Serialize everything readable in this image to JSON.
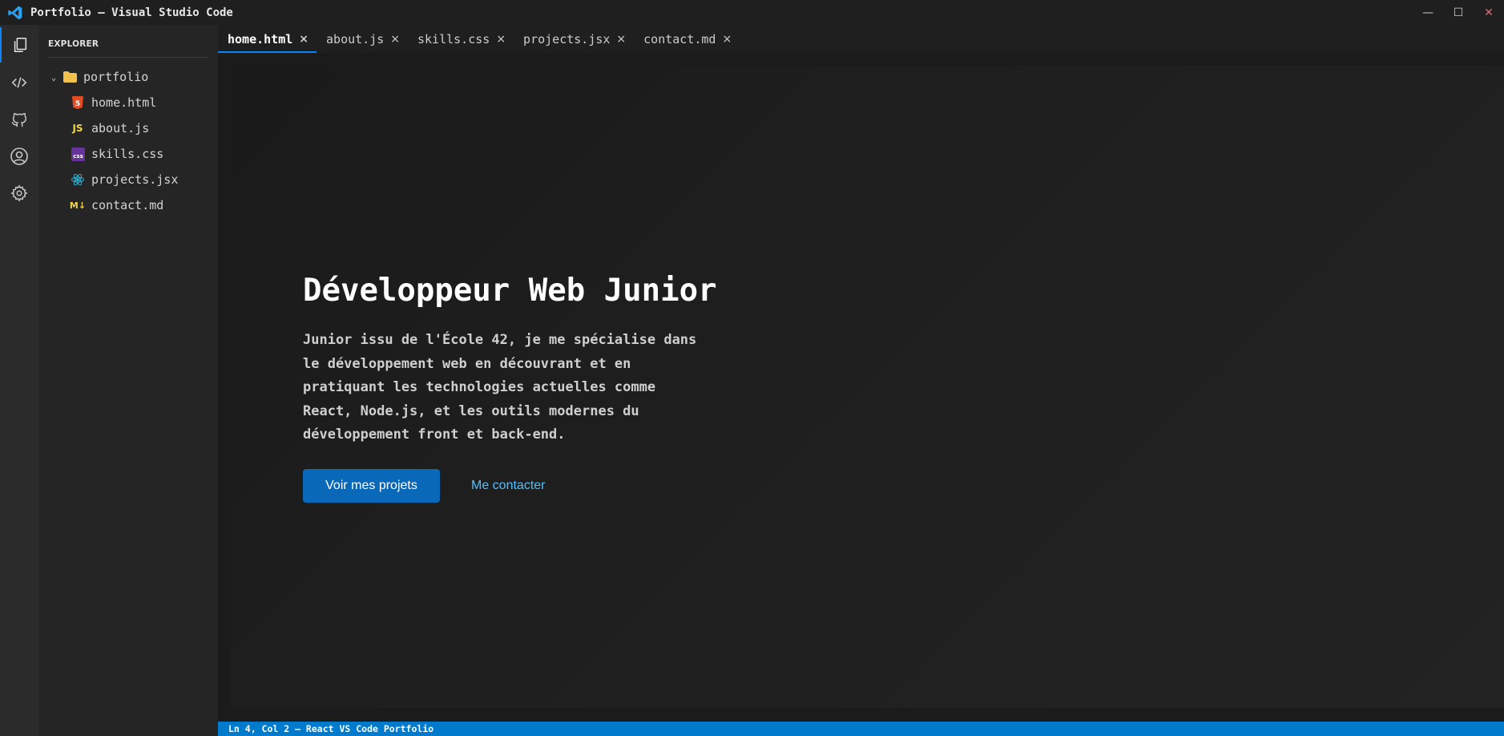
{
  "window": {
    "title": "Portfolio – Visual Studio Code",
    "controls": {
      "minimize": "—",
      "maximize": "☐",
      "close": "✕"
    }
  },
  "activity_bar": [
    {
      "icon": "files-icon",
      "active": true
    },
    {
      "icon": "code-icon",
      "active": false
    },
    {
      "icon": "github-icon",
      "active": false
    },
    {
      "icon": "account-icon",
      "active": false
    },
    {
      "icon": "settings-gear-icon",
      "active": false
    }
  ],
  "sidebar": {
    "header": "EXPLORER",
    "folder": {
      "chevron": "⌄",
      "name": "portfolio",
      "icon": "folder-icon"
    },
    "files": [
      {
        "name": "home.html",
        "icon": "html5-icon",
        "badge": "5",
        "color": "#e44d26"
      },
      {
        "name": "about.js",
        "icon": "javascript-icon",
        "badge": "JS",
        "color": "#f1d44c"
      },
      {
        "name": "skills.css",
        "icon": "css-icon",
        "badge": "css",
        "color": "#663399"
      },
      {
        "name": "projects.jsx",
        "icon": "react-icon",
        "badge": "",
        "color": "#2fb4d6"
      },
      {
        "name": "contact.md",
        "icon": "markdown-icon",
        "badge": "M↓",
        "color": "#f1d44c"
      }
    ]
  },
  "tabs": [
    {
      "label": "home.html",
      "close": "×",
      "active": true
    },
    {
      "label": "about.js",
      "close": "×",
      "active": false
    },
    {
      "label": "skills.css",
      "close": "×",
      "active": false
    },
    {
      "label": "projects.jsx",
      "close": "×",
      "active": false
    },
    {
      "label": "contact.md",
      "close": "×",
      "active": false
    }
  ],
  "hero": {
    "title": "Développeur Web Junior",
    "description_lines": [
      "Junior issu de l'École 42, je me spécialise dans",
      "le développement web en découvrant et en",
      "pratiquant les technologies actuelles comme",
      "React, Node.js, et les outils modernes du",
      "développement front et back-end."
    ],
    "primary_button": "Voir mes projets",
    "secondary_link": "Me contacter"
  },
  "statusbar": {
    "text": "Ln 4, Col 2 — React VS Code Portfolio"
  },
  "colors": {
    "accent": "#0a84ff",
    "statusbar": "#007acc",
    "button": "#0a68b8",
    "link": "#4fc1ff"
  }
}
